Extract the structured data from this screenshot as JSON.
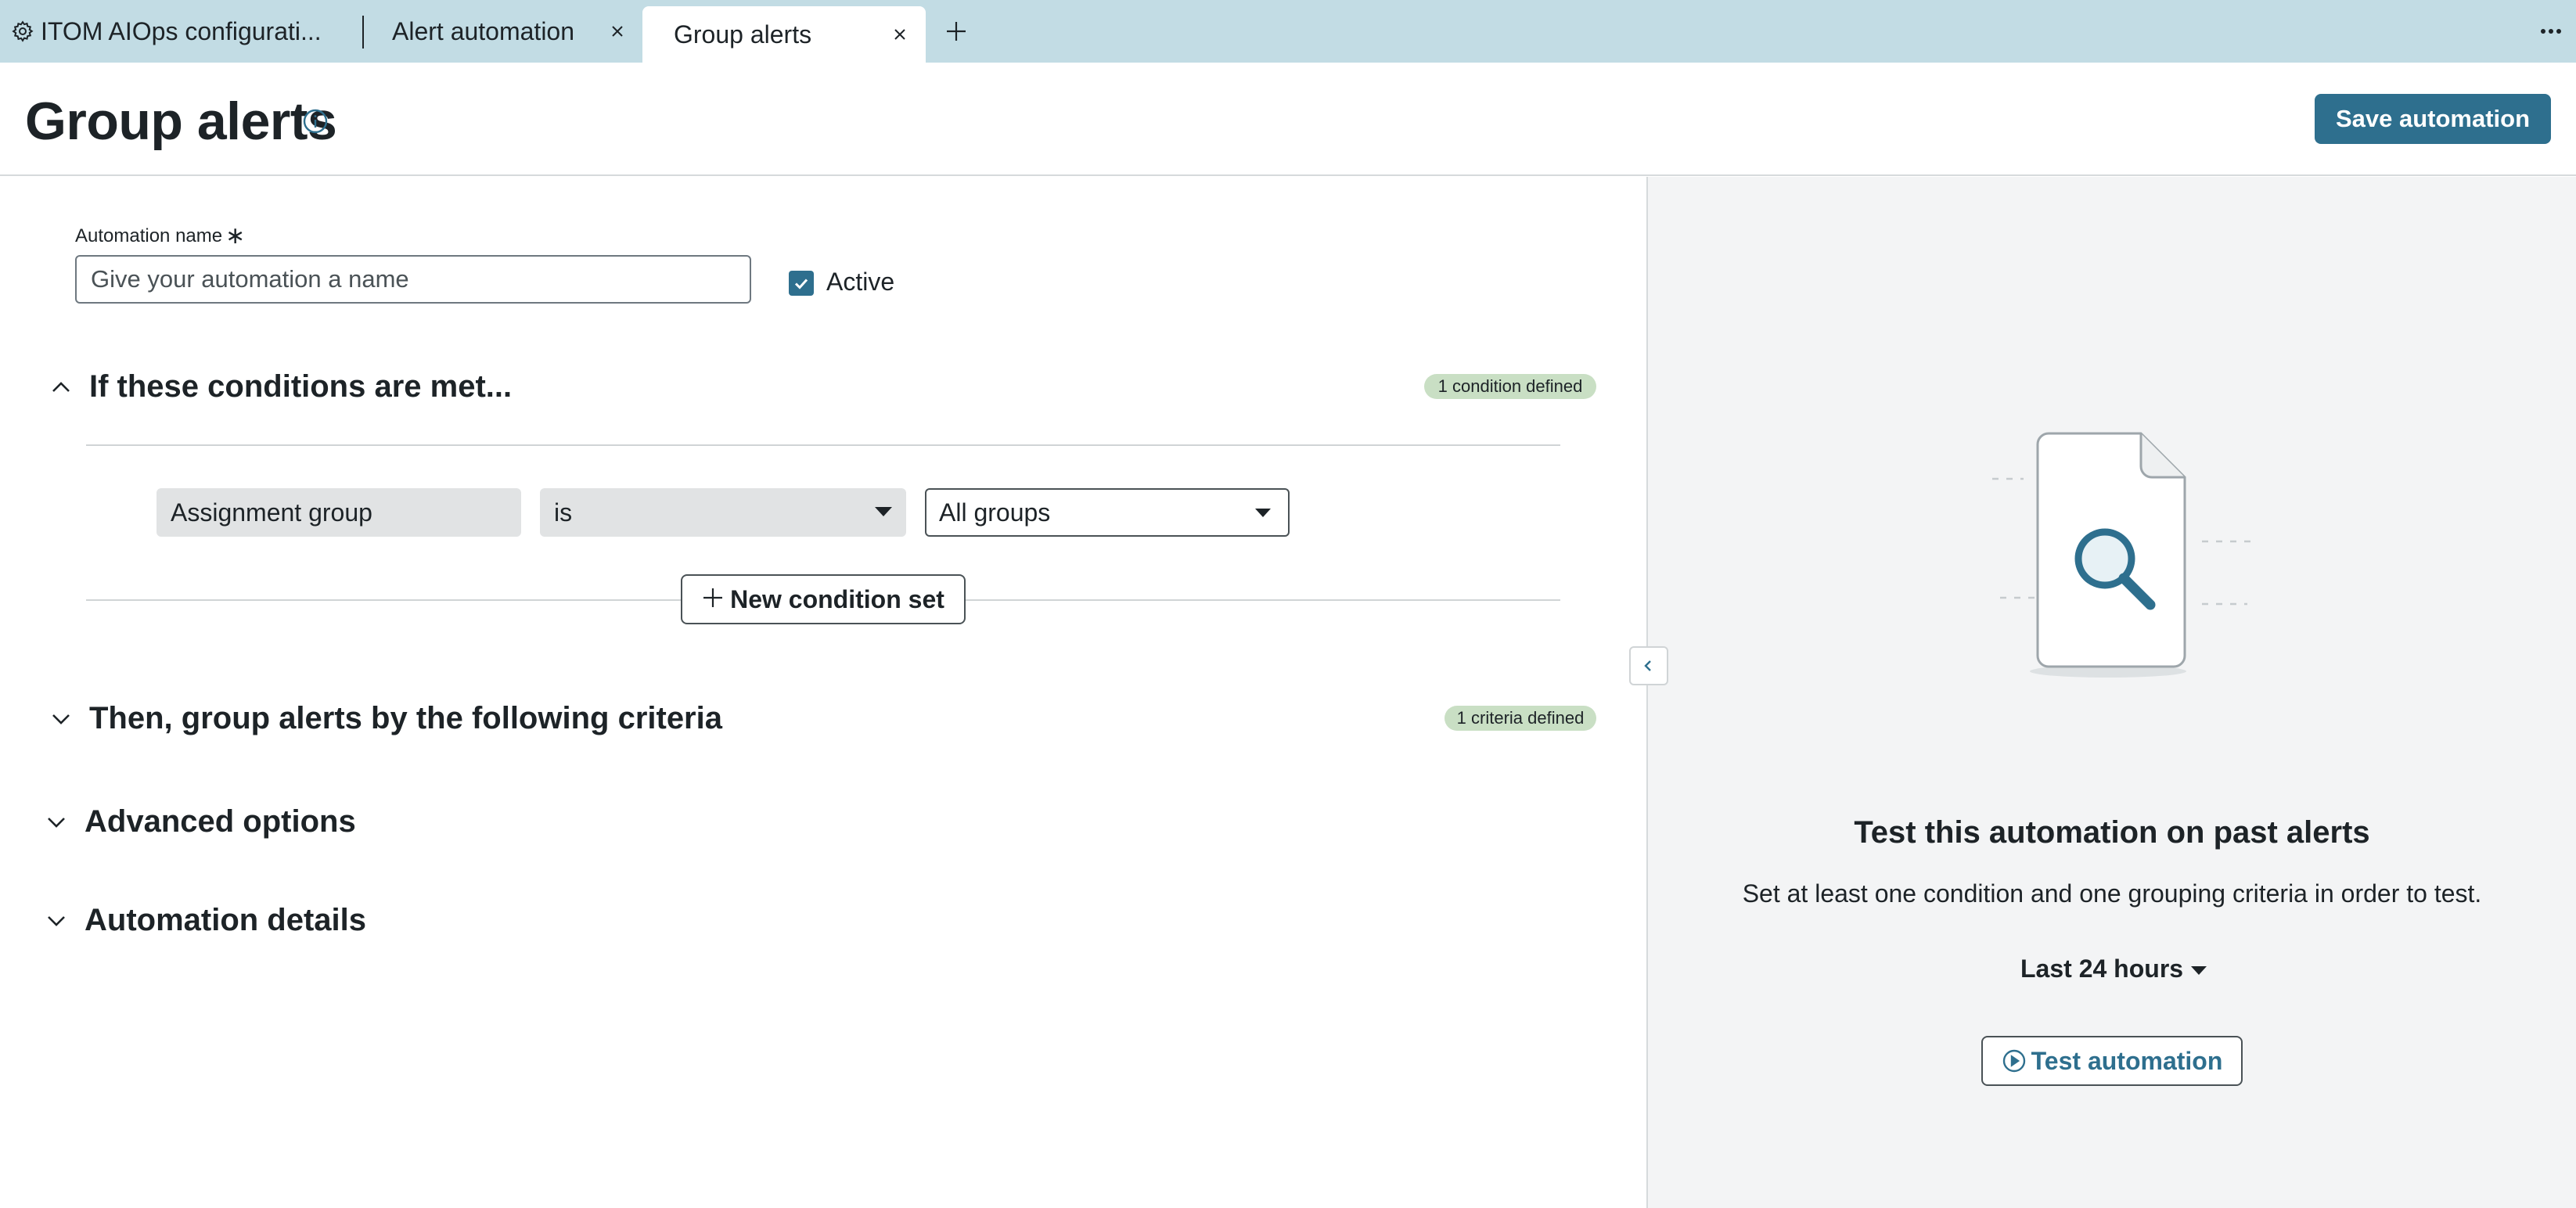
{
  "tabs": [
    {
      "label": "ITOM AIOps configurati...",
      "icon": "gear-icon"
    },
    {
      "label": "Alert automation"
    },
    {
      "label": "Group alerts",
      "active": true
    }
  ],
  "header": {
    "title": "Group alerts",
    "save_label": "Save automation"
  },
  "form": {
    "name_label": "Automation name",
    "required_marker": "∗",
    "name_placeholder": "Give your automation a name",
    "name_value": "",
    "active_label": "Active",
    "active_checked": true
  },
  "sections": {
    "conditions": {
      "title": "If these conditions are met...",
      "badge": "1 condition defined",
      "expanded": true
    },
    "grouping": {
      "title": "Then, group alerts by the following criteria",
      "badge": "1 criteria defined",
      "expanded": false
    },
    "advanced": {
      "title": "Advanced options",
      "expanded": false
    },
    "details": {
      "title": "Automation details",
      "expanded": false
    }
  },
  "condition": {
    "field": "Assignment group",
    "operator": "is",
    "value": "All groups"
  },
  "new_condition_set_label": "New condition set",
  "test_panel": {
    "title": "Test this automation on past alerts",
    "description": "Set at least one condition and one grouping criteria in order to test.",
    "range": "Last 24 hours",
    "test_label": "Test automation"
  },
  "colors": {
    "tabbar": "#c2dce4",
    "primary": "#2e6f8e",
    "badge": "#c9dfc4",
    "panel_bg": "#f3f4f5"
  }
}
